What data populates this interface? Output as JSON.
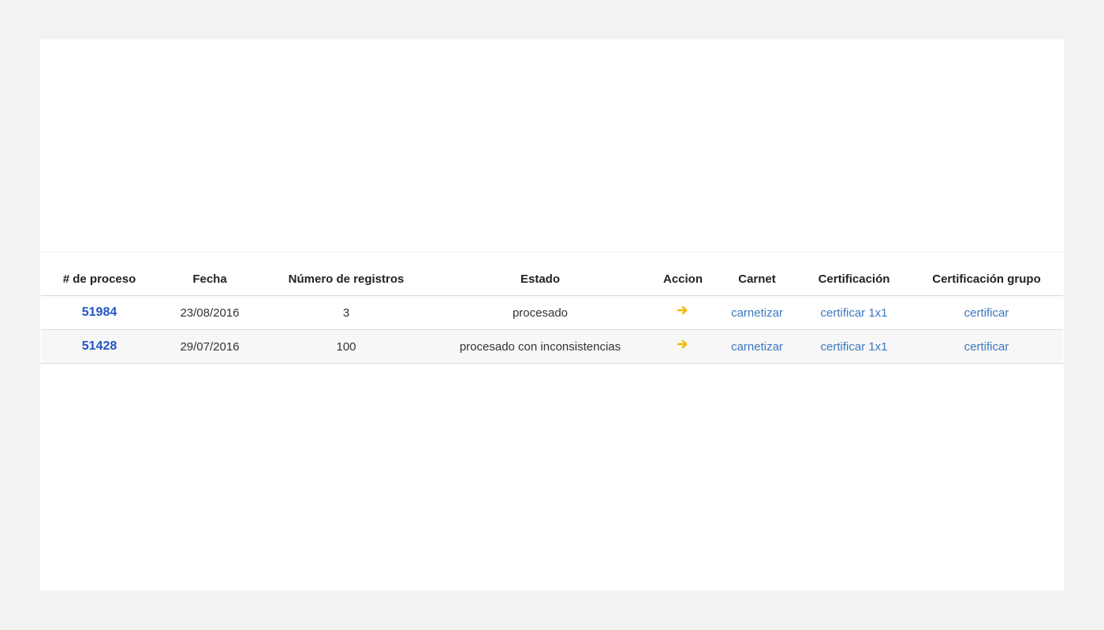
{
  "table": {
    "headers": {
      "process": "# de proceso",
      "date": "Fecha",
      "records": "Número de registros",
      "status": "Estado",
      "action": "Accion",
      "carnet": "Carnet",
      "certification": "Certificación",
      "group_certification": "Certificación grupo"
    },
    "rows": [
      {
        "process": "51984",
        "date": "23/08/2016",
        "records": "3",
        "status": "procesado",
        "action_icon": "arrow-right-icon",
        "carnet": "carnetizar",
        "certification": "certificar 1x1",
        "group_certification": "certificar"
      },
      {
        "process": "51428",
        "date": "29/07/2016",
        "records": "100",
        "status": "procesado con inconsistencias",
        "action_icon": "arrow-right-icon",
        "carnet": "carnetizar",
        "certification": "certificar 1x1",
        "group_certification": "certificar"
      }
    ]
  },
  "colors": {
    "background": "#f2f2f2",
    "panel": "#ffffff",
    "process_link": "#2255c8",
    "link": "#3b78c0",
    "action_arrow": "#f5b800",
    "alt_row": "#f7f7f7"
  }
}
